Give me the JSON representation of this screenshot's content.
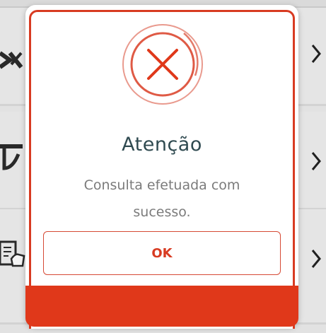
{
  "dialog": {
    "title": "Atenção",
    "message": "Consulta efetuada com sucesso.",
    "ok_label": "OK",
    "status_icon": "close-circle-icon"
  },
  "background_list": {
    "rows": [
      {
        "icon": "pix-icon"
      },
      {
        "icon": "payment-terminal-icon"
      },
      {
        "icon": "document-thumbs-up-icon"
      }
    ],
    "chevron_icon": "chevron-right-icon"
  },
  "colors": {
    "accent": "#e0381a",
    "title": "#2f4a50",
    "message": "#7b7b7b"
  }
}
